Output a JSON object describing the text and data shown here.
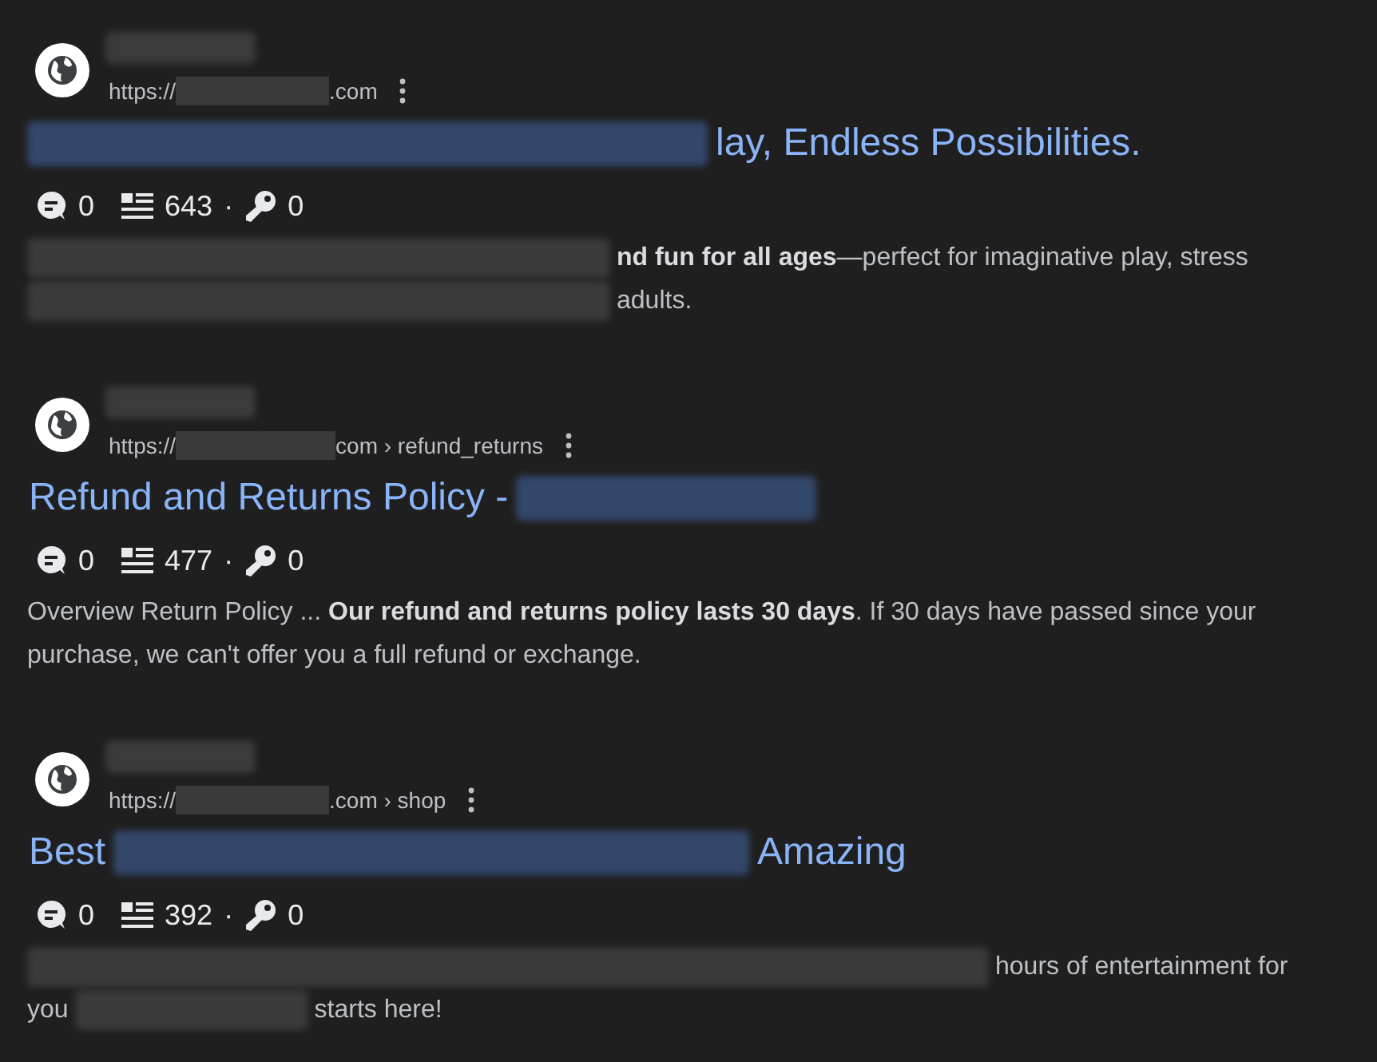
{
  "results": [
    {
      "url": [
        {
          "kind": "text",
          "text": "https://"
        },
        {
          "kind": "redacted"
        },
        {
          "kind": "text",
          "text": ".com"
        }
      ],
      "title": [
        {
          "kind": "redacted"
        },
        {
          "kind": "text",
          "text": "lay, Endless Possibilities."
        }
      ],
      "stats": {
        "comments": "0",
        "words": "643",
        "separator": "·",
        "keywords": "0"
      },
      "snippet": [
        [
          {
            "kind": "redacted"
          },
          {
            "kind": "text",
            "text": "**nd fun for all ages**—perfect for imaginative play, stress"
          }
        ],
        [
          {
            "kind": "redacted"
          },
          {
            "kind": "text",
            "text": "adults."
          }
        ]
      ]
    },
    {
      "url": [
        {
          "kind": "text",
          "text": "https://"
        },
        {
          "kind": "redacted"
        },
        {
          "kind": "text",
          "text": "com › refund_returns"
        }
      ],
      "title": [
        {
          "kind": "text",
          "text": "Refund and Returns Policy -"
        },
        {
          "kind": "redacted"
        }
      ],
      "stats": {
        "comments": "0",
        "words": "477",
        "separator": "·",
        "keywords": "0"
      },
      "snippet": [
        [
          {
            "kind": "text",
            "text": "Overview Return Policy ... **Our refund and returns policy lasts 30 days**. If 30 days have passed since your purchase, we can't offer you a full refund or exchange."
          }
        ]
      ]
    },
    {
      "url": [
        {
          "kind": "text",
          "text": "https://"
        },
        {
          "kind": "redacted"
        },
        {
          "kind": "text",
          "text": ".com › shop"
        }
      ],
      "title": [
        {
          "kind": "text",
          "text": "Best"
        },
        {
          "kind": "redacted"
        },
        {
          "kind": "text",
          "text": "Amazing"
        }
      ],
      "stats": {
        "comments": "0",
        "words": "392",
        "separator": "·",
        "keywords": "0"
      },
      "snippet": [
        [
          {
            "kind": "redacted"
          },
          {
            "kind": "text",
            "text": "hours of entertainment for"
          }
        ],
        [
          {
            "kind": "text",
            "text": "you"
          },
          {
            "kind": "redacted"
          },
          {
            "kind": "text",
            "text": "starts here!"
          }
        ]
      ]
    }
  ]
}
